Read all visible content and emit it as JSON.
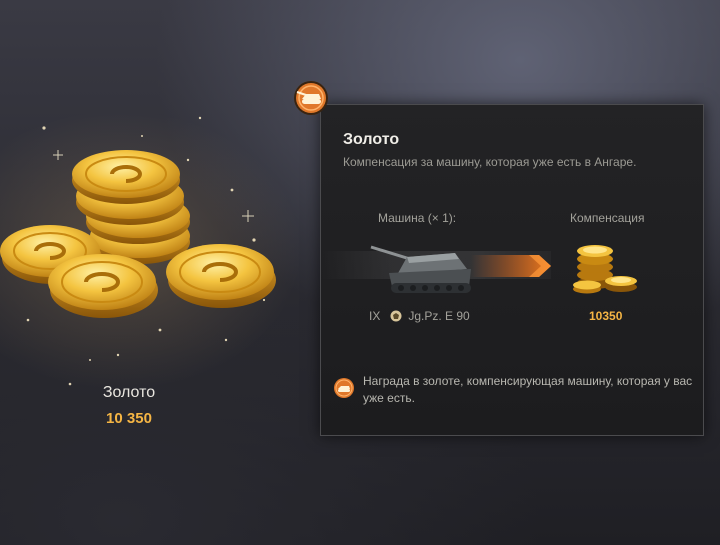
{
  "reward": {
    "name": "Золото",
    "amount": "10 350",
    "icon": "gold-coins-icon"
  },
  "tooltip": {
    "badge_icon": "gold-compensation-icon",
    "title": "Золото",
    "description": "Компенсация за машину, которая уже есть в Ангаре.",
    "vehicle_column_label": "Машина (× 1):",
    "compensation_column_label": "Компенсация",
    "vehicle": {
      "tier": "IX",
      "nation_icon": "germany-emblem-icon",
      "name": "Jg.Pz. E 90"
    },
    "compensation_value": "10350",
    "note_icon": "gold-compensation-icon",
    "note_text": "Награда в золоте, компенсирующая машину, которая у вас уже есть."
  },
  "colors": {
    "gold": "#f5b544",
    "arrow": "#e8671c",
    "panel_border": "#4b4b4e"
  }
}
